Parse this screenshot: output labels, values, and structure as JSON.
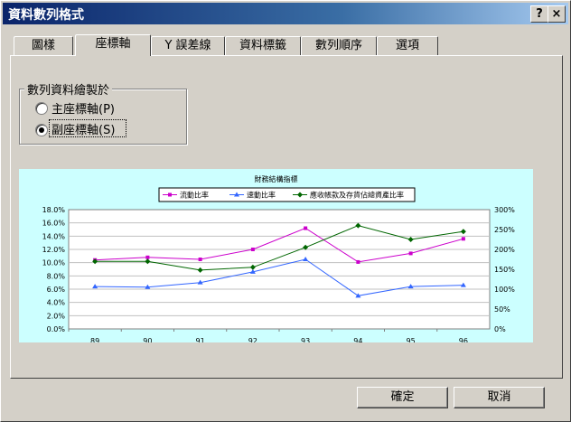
{
  "window": {
    "title": "資料數列格式",
    "help_label": "?",
    "close_label": "×"
  },
  "tabs": [
    {
      "label": "圖樣"
    },
    {
      "label": "座標軸"
    },
    {
      "label": "Y 誤差線"
    },
    {
      "label": "資料標籤"
    },
    {
      "label": "數列順序"
    },
    {
      "label": "選項"
    }
  ],
  "active_tab": "座標軸",
  "axis_group": {
    "title": "數列資料繪製於",
    "options": [
      {
        "label": "主座標軸(P)",
        "selected": false
      },
      {
        "label": "副座標軸(S)",
        "selected": true
      }
    ]
  },
  "chart_data": {
    "type": "line",
    "title": "財務結構指標",
    "background": "#ccffff",
    "categories": [
      "89",
      "90",
      "91",
      "92",
      "93",
      "94",
      "95",
      "96"
    ],
    "y_left": {
      "ticks": [
        "18.0%",
        "16.0%",
        "14.0%",
        "12.0%",
        "10.0%",
        "8.0%",
        "6.0%",
        "4.0%",
        "2.0%",
        "0.0%"
      ],
      "range": [
        0,
        18
      ]
    },
    "y_right": {
      "ticks": [
        "300%",
        "250%",
        "200%",
        "150%",
        "100%",
        "50%",
        "0%"
      ],
      "range": [
        0,
        300
      ]
    },
    "series": [
      {
        "name": "流動比率",
        "axis": "left",
        "color": "#cc00cc",
        "marker": "square",
        "values": [
          10.4,
          10.8,
          10.5,
          12.0,
          15.2,
          10.1,
          11.4,
          13.6
        ]
      },
      {
        "name": "速動比率",
        "axis": "left",
        "color": "#3366ff",
        "marker": "triangle",
        "values": [
          6.4,
          6.3,
          7.0,
          8.6,
          10.5,
          5.0,
          6.4,
          6.6
        ]
      },
      {
        "name": "應收帳款及存貨佔總資產比率",
        "axis": "right",
        "color": "#006600",
        "marker": "diamond",
        "values": [
          170,
          170,
          148,
          155,
          205,
          260,
          225,
          245
        ]
      }
    ],
    "legend_position": "top",
    "grid": true
  },
  "buttons": {
    "ok": "確定",
    "cancel": "取消"
  }
}
